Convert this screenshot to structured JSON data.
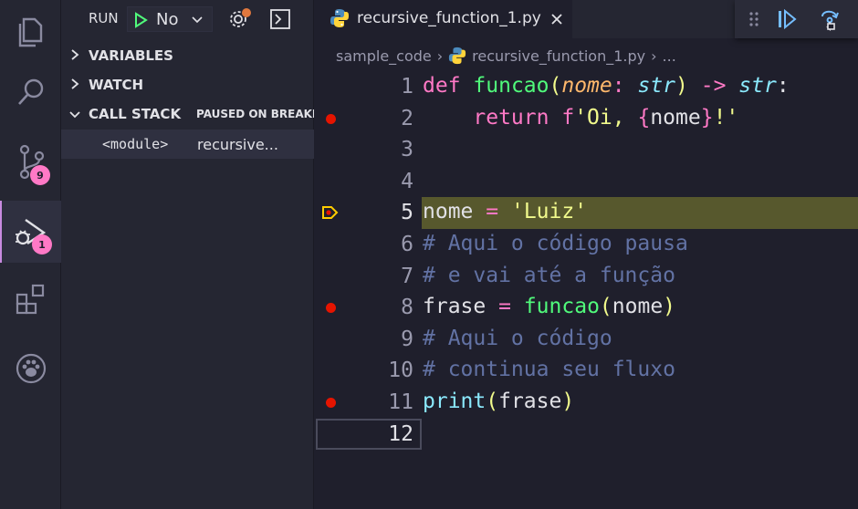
{
  "activity_bar": {
    "items": [
      {
        "icon": "files-icon"
      },
      {
        "icon": "search-icon"
      },
      {
        "icon": "source-control-icon",
        "badge": "9"
      },
      {
        "icon": "run-debug-icon",
        "badge": "1",
        "active": true
      },
      {
        "icon": "extensions-icon"
      },
      {
        "icon": "paw-icon"
      }
    ]
  },
  "sidebar": {
    "run_label": "RUN",
    "config_value": "No",
    "sections": {
      "variables": "VARIABLES",
      "watch": "WATCH",
      "call_stack": "CALL STACK",
      "call_stack_status": "PAUSED ON BREAKP"
    },
    "stack_frame": {
      "name": "<module>",
      "file": "recursive..."
    }
  },
  "editor": {
    "tab_title": "recursive_function_1.py",
    "breadcrumbs": {
      "folder": "sample_code",
      "file": "recursive_function_1.py",
      "more": "..."
    },
    "current_line": 5,
    "breakpoint_lines": [
      2,
      8,
      11
    ],
    "line_numbers": [
      "1",
      "2",
      "3",
      "4",
      "5",
      "6",
      "7",
      "8",
      "9",
      "10",
      "11",
      "12"
    ],
    "code": {
      "l1": {
        "kw": "def",
        "fn": "funcao",
        "open": "(",
        "param": "nome",
        "colon": ":",
        "type": "str",
        "close": ")",
        "arrow": "->",
        "ret": "str",
        "end": ":"
      },
      "l2": {
        "indent": "    ",
        "kw": "return",
        "prefix": "f",
        "q1": "'Oi, ",
        "lb": "{",
        "var": "nome",
        "rb": "}",
        "q2": "!'"
      },
      "l5": {
        "var": "nome",
        "op": "=",
        "str": "'Luiz'"
      },
      "l6": "# Aqui o código pausa",
      "l7": "# e vai até a função",
      "l8": {
        "var": "frase",
        "op": "=",
        "fn": "funcao",
        "open": "(",
        "arg": "nome",
        "close": ")"
      },
      "l9": "# Aqui o código",
      "l10": "# continua seu fluxo",
      "l11": {
        "fn": "print",
        "open": "(",
        "arg": "frase",
        "close": ")"
      }
    }
  },
  "colors": {
    "accent": "#c88ae0",
    "badge": "#ff79c6",
    "breakpoint": "#e51400",
    "current_line": "#57582d"
  }
}
